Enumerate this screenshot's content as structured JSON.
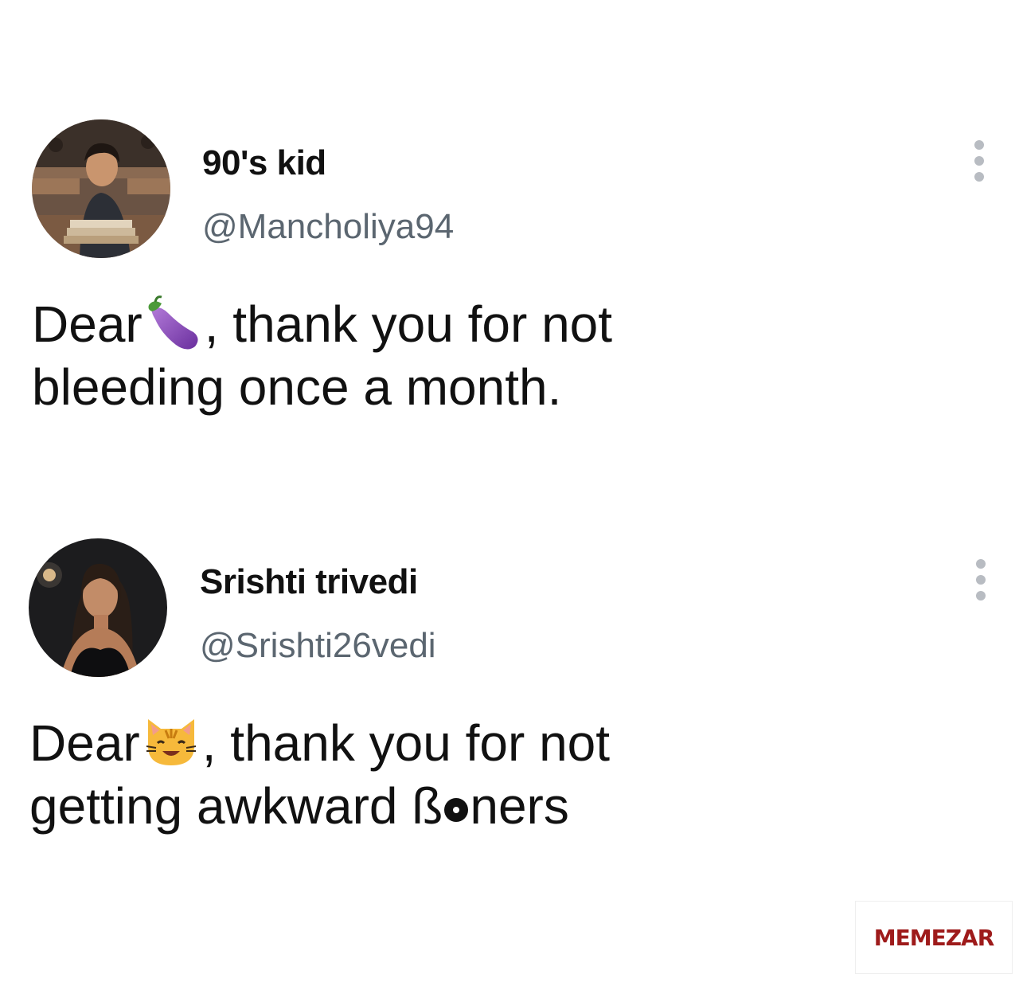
{
  "posts": [
    {
      "display_name": "90's kid",
      "handle": "@Mancholiya94",
      "text_line1_before": "Dear",
      "text_emoji": "eggplant-emoji",
      "text_line1_after": ", thank you for not",
      "text_line2": "bleeding once a month.",
      "avatar": "student-in-library-avatar",
      "menu_icon": "more-vertical-icon"
    },
    {
      "display_name": "Srishti trivedi",
      "handle": "@Srishti26vedi",
      "text_line1_before": "Dear",
      "text_emoji": "smiling-cat-emoji",
      "text_line1_after": ", thank you for not",
      "text_line2_before": "getting awkward ß",
      "text_line2_after": "ners",
      "avatar": "woman-portrait-avatar",
      "menu_icon": "more-vertical-icon"
    }
  ],
  "watermark": {
    "text": "MEMEZAR",
    "color": "#9e1b1b"
  },
  "colors": {
    "handle": "#5b6670",
    "menu_dots": "#b8bcc2"
  }
}
